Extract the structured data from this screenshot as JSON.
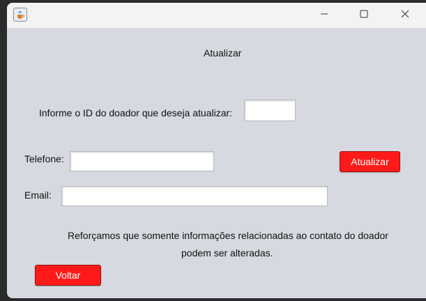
{
  "titlebar": {
    "app_icon": "java-cup-icon",
    "minimize_icon": "minimize-icon",
    "maximize_icon": "maximize-icon",
    "close_icon": "close-icon"
  },
  "form": {
    "heading": "Atualizar",
    "id_label": "Informe o ID do doador que deseja atualizar:",
    "id_value": "",
    "telefone_label": "Telefone:",
    "telefone_value": "",
    "email_label": "Email:",
    "email_value": "",
    "update_button": "Atualizar",
    "note_line1": "Reforçamos que somente informações relacionadas ao contato do doador",
    "note_line2": "podem ser alteradas.",
    "back_button": "Voltar"
  },
  "colors": {
    "window_bg": "#d6d9e0",
    "button_red": "#ff1a1a",
    "titlebar_bg": "#f3f3f3"
  }
}
